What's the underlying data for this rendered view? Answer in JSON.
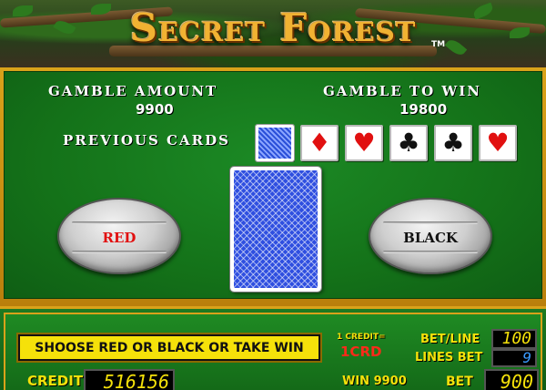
{
  "game": {
    "title": "Secret Forest",
    "trademark": "TM"
  },
  "gamble": {
    "amount_label": "GAMBLE AMOUNT",
    "amount_value": "9900",
    "towin_label": "GAMBLE TO WIN",
    "towin_value": "19800",
    "previous_cards_label": "PREVIOUS CARDS",
    "previous_cards": [
      {
        "type": "back",
        "icon": "card-back-icon",
        "color": "#2a4fd8",
        "glyph": ""
      },
      {
        "type": "diamond",
        "icon": "diamond-icon",
        "color": "#e11010",
        "glyph": "♦"
      },
      {
        "type": "heart",
        "icon": "heart-icon",
        "color": "#e11010",
        "glyph": "♥"
      },
      {
        "type": "club",
        "icon": "club-icon",
        "color": "#111111",
        "glyph": "♣"
      },
      {
        "type": "club",
        "icon": "club-icon",
        "color": "#111111",
        "glyph": "♣"
      },
      {
        "type": "heart",
        "icon": "heart-icon",
        "color": "#e11010",
        "glyph": "♥"
      }
    ],
    "red_button": "RED",
    "black_button": "BLACK"
  },
  "panel": {
    "message": "SHOOSE RED OR BLACK OR TAKE WIN",
    "credit_label": "CREDIT",
    "credit_value": "516156",
    "credit_rate_label": "1 CREDIT=",
    "credit_rate_value": "1CRD",
    "win_label": "WIN",
    "win_value": "9900",
    "bet_line_label": "BET/LINE",
    "bet_line_value": "100",
    "lines_bet_label": "LINES BET",
    "lines_bet_value": "9",
    "bet_label": "BET",
    "bet_value": "900"
  },
  "colors": {
    "table_green": "#147219",
    "gold_frame": "#d9a21a",
    "message_yellow": "#f5e10a",
    "card_blue": "#2f4fe0"
  }
}
